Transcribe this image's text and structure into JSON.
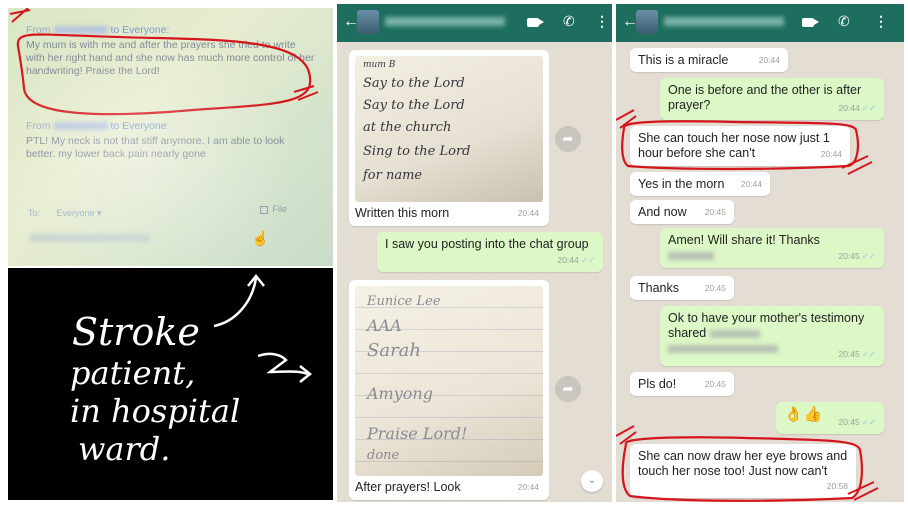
{
  "zoom_chat": {
    "msg1_from_prefix": "From",
    "msg1_to": "to Everyone:",
    "msg1_text": "My mum is with me and after the prayers she tried to write with her right hand and she now has much more control of her handwriting! Praise the Lord!",
    "msg2_from_prefix": "From",
    "msg2_to": "to Everyone:",
    "msg2_text": "PTL! My neck is not that stiff anymore. I am able to look better. my lower back pain nearly gone",
    "footer_to_label": "To:",
    "footer_to_value": "Everyone ▾",
    "file_label": "File"
  },
  "caption": {
    "line1": "Stroke",
    "line2": "patient,",
    "line3": "in hospital",
    "line4": "ward."
  },
  "wa_left": {
    "photo1_lines": [
      "mum B",
      "Say to the Lord",
      "Say to the Lord",
      "at the church",
      "Sing to the Lord",
      "for name"
    ],
    "photo1_caption": "Written this morn",
    "photo1_time": "20:44",
    "msg_out_text": "I saw you posting into the chat group",
    "msg_out_time": "20:44",
    "photo2_lines": [
      "Eunice Lee",
      "AAA",
      "Sarah",
      "Amyong",
      "Praise Lord!",
      "done"
    ],
    "photo2_caption": "After prayers! Look",
    "photo2_time": "20:44"
  },
  "wa_right": {
    "m1": {
      "text": "This is a miracle",
      "time": "20:44"
    },
    "m2": {
      "text": "One is before and the other is after prayer?",
      "time": "20:44"
    },
    "m3": {
      "text": "She can touch her nose now just 1 hour before she can't",
      "time": "20:44"
    },
    "m4": {
      "text": "Yes in the morn",
      "time": "20:44"
    },
    "m5": {
      "text": "And now",
      "time": "20:45"
    },
    "m6": {
      "text": "Amen! Will share it! Thanks",
      "time": "20:45"
    },
    "m7": {
      "text": "Thanks",
      "time": "20:45"
    },
    "m8": {
      "text": "Ok to have your mother's testimony shared",
      "time": "20:45"
    },
    "m9": {
      "text": "Pls do!",
      "time": "20:45"
    },
    "m10": {
      "text": "👌👍",
      "time": "20:45"
    },
    "m11": {
      "text": "She can now draw her eye brows and touch her nose too! Just now can't",
      "time": "20:58"
    }
  },
  "icons": {
    "back": "back-arrow-icon",
    "video": "video-call-icon",
    "call": "phone-icon",
    "menu": "overflow-menu-icon",
    "share": "share-arrow-icon",
    "scroll": "scroll-down-icon"
  },
  "colors": {
    "wa_header": "#1d6e5e",
    "wa_bg": "#e4ddd4",
    "bubble_out": "#dcf8c6",
    "bubble_in": "#ffffff",
    "annotation_red": "#d4161c",
    "zoom_bg": "#dfe8c8"
  }
}
